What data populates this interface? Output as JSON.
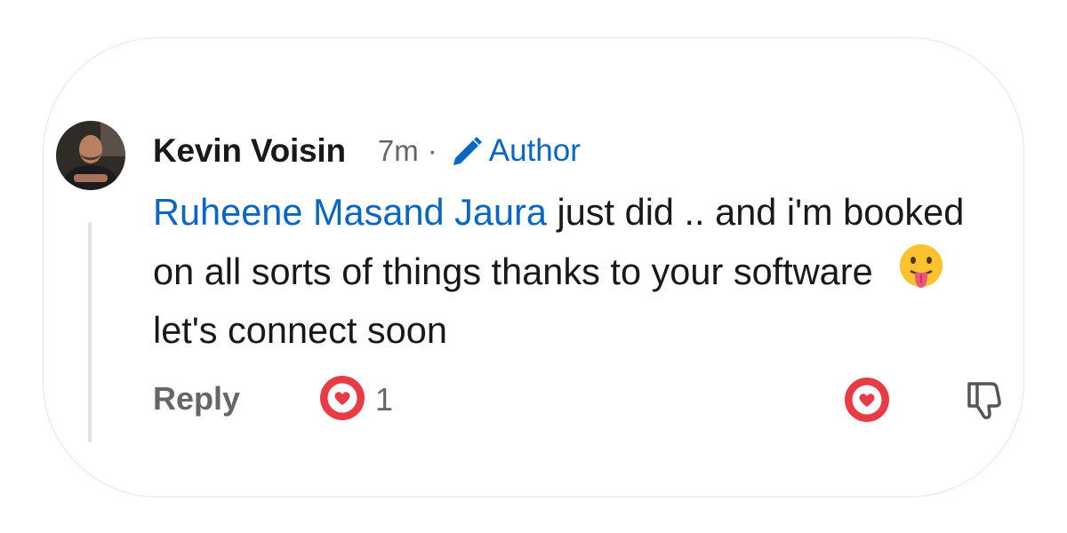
{
  "comment": {
    "author_name": "Kevin Voisin",
    "timestamp": "7m",
    "separator": "·",
    "author_badge": "Author",
    "mention": "Ruheene Masand Jaura",
    "text_before_emoji": " just did .. and i'm booked on all sorts of things thanks to your software ",
    "emoji": "face-with-tongue-emoji",
    "text_after_emoji": " let's connect soon"
  },
  "actions": {
    "reply_label": "Reply",
    "reaction_icon": "heart-reaction-icon",
    "reaction_count": "1",
    "like_icon": "heart-icon",
    "dislike_icon": "thumbs-down-icon"
  },
  "colors": {
    "link_blue": "#0a66c2",
    "heart_red": "#e73c45",
    "text_dark": "#191919",
    "text_muted": "#666666"
  }
}
